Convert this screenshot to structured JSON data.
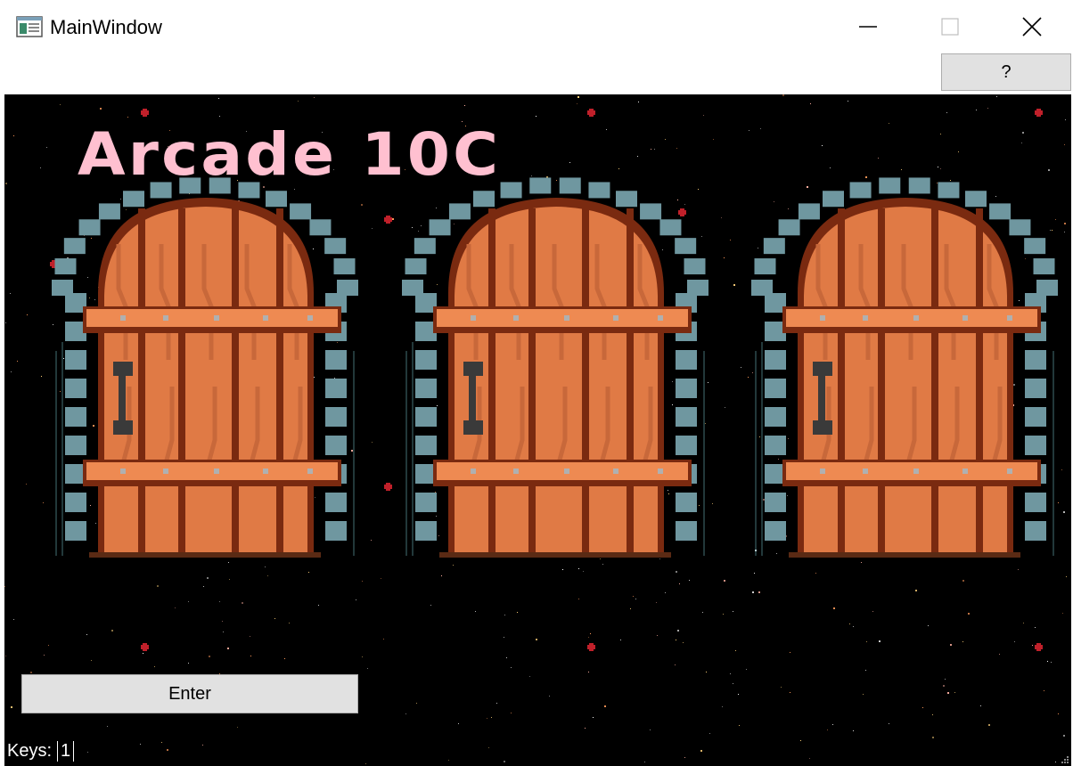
{
  "window": {
    "title": "MainWindow",
    "icon": "app-window-icon",
    "controls": [
      "minimize-icon",
      "maximize-icon",
      "close-icon"
    ]
  },
  "toolbar": {
    "help_label": "?"
  },
  "game": {
    "title": "Arcade 10C",
    "title_color": "#ffc0d0",
    "background": "#000000",
    "doors": [
      {
        "name": "door-1"
      },
      {
        "name": "door-2"
      },
      {
        "name": "door-3"
      }
    ],
    "door_colors": {
      "wood": "#e07a45",
      "wood_dark": "#7a2a10",
      "stone": "#6f97a0",
      "handle": "#3a3a3a"
    },
    "enter_label": "Enter",
    "keys_label": "Keys:",
    "keys_value": "1"
  }
}
